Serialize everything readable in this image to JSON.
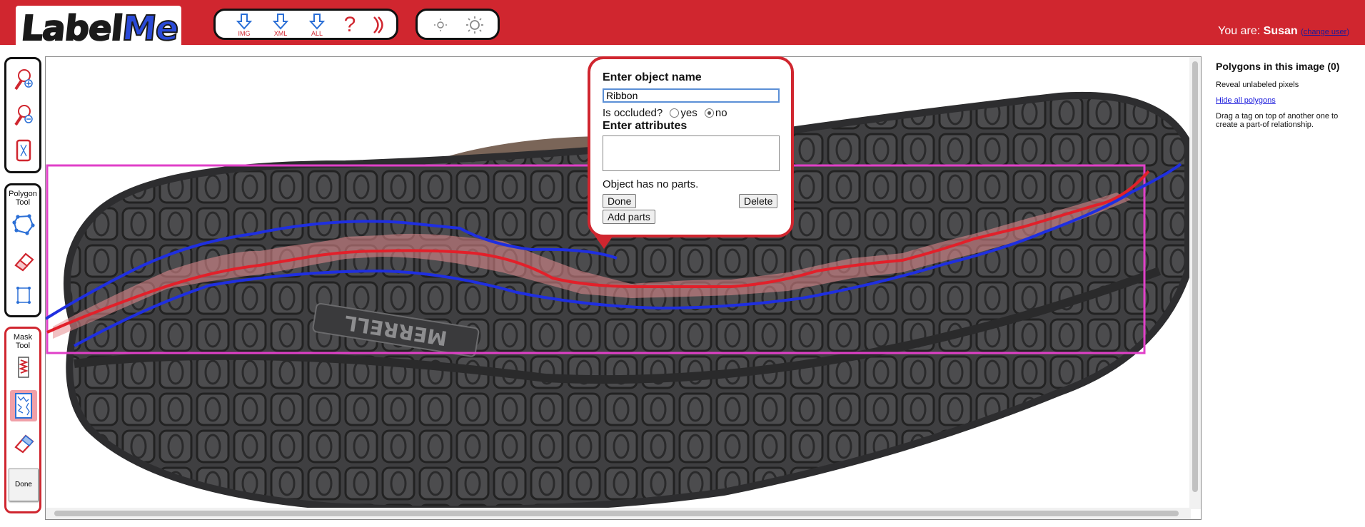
{
  "app": {
    "logo_text_a": "Label",
    "logo_text_b": "Me"
  },
  "toolbar": {
    "download_img_label": "IMG",
    "download_xml_label": "XML",
    "download_all_label": "ALL",
    "help_glyph": "?",
    "help_icon": "question-icon",
    "signout_icon": "moon-icon",
    "brightness_down_icon": "sun-small-icon",
    "brightness_up_icon": "sun-large-icon"
  },
  "user": {
    "prefix": "You are: ",
    "name": "Susan",
    "open_paren": "(",
    "change_link": "change user",
    "close_paren": ")"
  },
  "left_tools": {
    "zoom_in_icon": "zoom-in-icon",
    "zoom_out_icon": "zoom-out-icon",
    "fit_icon": "fit-to-screen-icon",
    "polygon_title": "Polygon Tool",
    "polygon_icon": "polygon-icon",
    "erase_icon": "eraser-icon",
    "bbox_icon": "bounding-box-icon",
    "mask_title": "Mask Tool",
    "scribble_fg_icon": "scribble-foreground-icon",
    "scribble_bg_icon": "scribble-background-icon",
    "mask_erase_icon": "mask-eraser-icon",
    "done_label": "Done"
  },
  "popup": {
    "name_heading": "Enter object name",
    "name_value": "Ribbon",
    "occluded_label": "Is occluded?",
    "occluded_yes": "yes",
    "occluded_no": "no",
    "occluded_selected": "no",
    "attributes_heading": "Enter attributes",
    "attributes_value": "",
    "parts_text": "Object has no parts.",
    "done_button": "Done",
    "delete_button": "Delete",
    "add_parts_button": "Add parts"
  },
  "canvas_image": {
    "brand_text": "MERRELL"
  },
  "colors": {
    "header_red": "#d0262f",
    "polygon_blue": "#1f2fe0",
    "polygon_red": "#e2202a",
    "bbox_magenta": "#e040c8",
    "link_blue": "#1a1adc"
  },
  "right_panel": {
    "title": "Polygons in this image (0)",
    "reveal_text": "Reveal unlabeled pixels",
    "hide_link": "Hide all polygons",
    "drag_text": "Drag a tag on top of another one to create a part-of relationship."
  }
}
